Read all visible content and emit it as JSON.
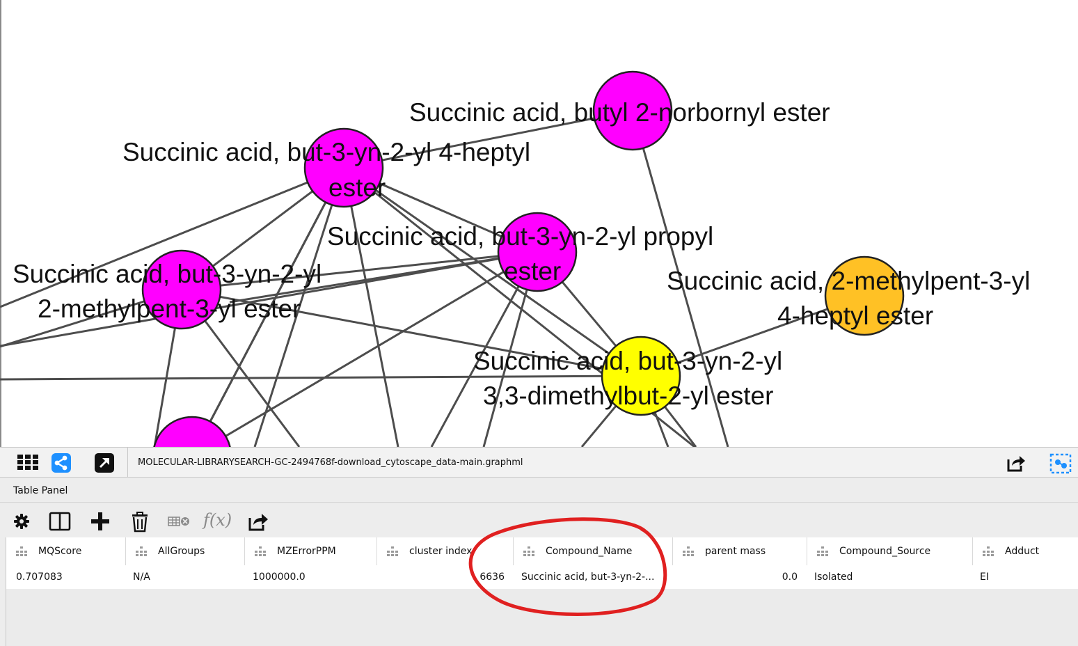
{
  "graph": {
    "nodes": [
      {
        "id": "n-butyl-norbornyl",
        "color": "#ff00ff",
        "label_lines": [
          "Succinic acid, butyl 2-norbornyl ester"
        ]
      },
      {
        "id": "n-but3yn-heptyl",
        "color": "#ff00ff",
        "label_lines": [
          "Succinic acid, but-3-yn-2-yl 4-heptyl",
          "ester"
        ]
      },
      {
        "id": "n-but3yn-propyl",
        "color": "#ff00ff",
        "label_lines": [
          "Succinic acid, but-3-yn-2-yl propyl",
          "ester"
        ]
      },
      {
        "id": "n-but3yn-methylpent",
        "color": "#ff00ff",
        "label_lines": [
          "Succinic acid, but-3-yn-2-yl",
          "2-methylpent-3-yl ester"
        ]
      },
      {
        "id": "n-methylpent-heptyl",
        "color": "#ffc125",
        "label_lines": [
          "Succinic acid, 2-methylpent-3-yl",
          "4-heptyl ester"
        ]
      },
      {
        "id": "n-but3yn-dimethylbut",
        "color": "#ffff00",
        "label_lines": [
          "Succinic acid, but-3-yn-2-yl",
          "3,3-dimethylbut-2-yl ester"
        ]
      },
      {
        "id": "n-partial-bottom",
        "color": "#ff00ff",
        "label_lines": []
      }
    ],
    "edge_color": "#4d4d4d",
    "node_border_color": "#222222"
  },
  "network_toolbar": {
    "file_name": "MOLECULAR-LIBRARYSEARCH-GC-2494768f-download_cytoscape_data-main.graphml"
  },
  "table_panel": {
    "title": "Table Panel",
    "columns": [
      "MQScore",
      "AllGroups",
      "MZErrorPPM",
      "cluster index",
      "Compound_Name",
      "parent mass",
      "Compound_Source",
      "Adduct"
    ],
    "rows": [
      [
        "0.707083",
        "N/A",
        "1000000.0",
        "6636",
        "Succinic acid, but-3-yn-2-...",
        "0.0",
        "Isolated",
        "EI"
      ]
    ],
    "annotation_color": "#e02020"
  },
  "colors": {
    "toolbar_bg": "#f2f2f2",
    "accent_blue": "#1e90ff",
    "icon_dark": "#111111"
  }
}
